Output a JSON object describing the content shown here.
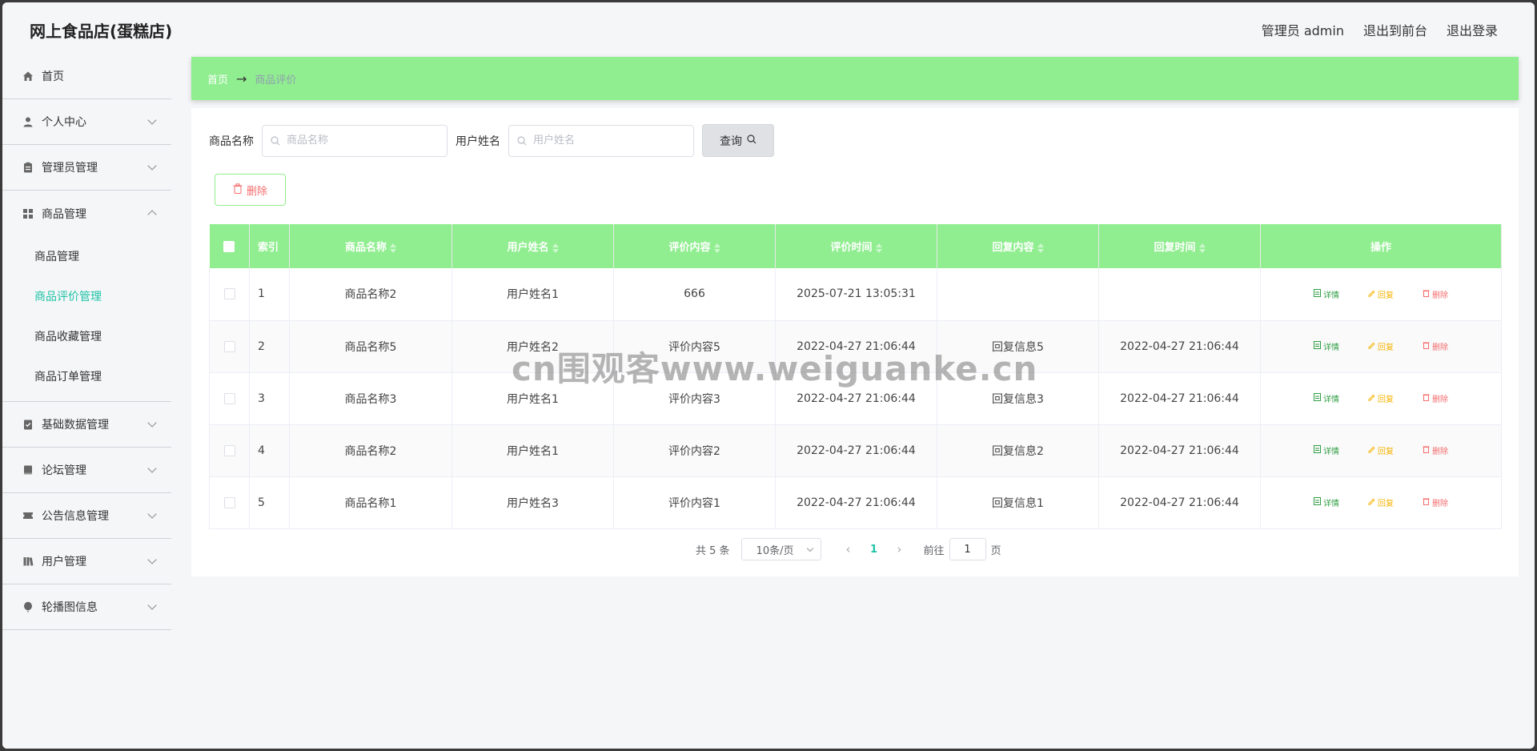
{
  "app": {
    "title": "网上食品店(蛋糕店)"
  },
  "topnav": {
    "admin_label": "管理员 admin",
    "front_link": "退出到前台",
    "logout_link": "退出登录"
  },
  "sidebar": {
    "items": [
      {
        "label": "首页"
      },
      {
        "label": "个人中心"
      },
      {
        "label": "管理员管理"
      },
      {
        "label": "商品管理",
        "children": [
          "商品管理",
          "商品评价管理",
          "商品收藏管理",
          "商品订单管理"
        ]
      },
      {
        "label": "基础数据管理"
      },
      {
        "label": "论坛管理"
      },
      {
        "label": "公告信息管理"
      },
      {
        "label": "用户管理"
      },
      {
        "label": "轮播图信息"
      }
    ]
  },
  "breadcrumb": {
    "home": "首页",
    "current": "商品评价"
  },
  "search": {
    "product_label": "商品名称",
    "product_placeholder": "商品名称",
    "user_label": "用户姓名",
    "user_placeholder": "用户姓名",
    "query_button": "查询"
  },
  "toolbar": {
    "delete_button": "删除"
  },
  "table": {
    "headers": [
      "索引",
      "商品名称",
      "用户姓名",
      "评价内容",
      "评价时间",
      "回复内容",
      "回复时间",
      "操作"
    ],
    "rows": [
      [
        "1",
        "商品名称2",
        "用户姓名1",
        "666",
        "2025-07-21 13:05:31",
        "",
        ""
      ],
      [
        "2",
        "商品名称5",
        "用户姓名2",
        "评价内容5",
        "2022-04-27 21:06:44",
        "回复信息5",
        "2022-04-27 21:06:44"
      ],
      [
        "3",
        "商品名称3",
        "用户姓名1",
        "评价内容3",
        "2022-04-27 21:06:44",
        "回复信息3",
        "2022-04-27 21:06:44"
      ],
      [
        "4",
        "商品名称2",
        "用户姓名1",
        "评价内容2",
        "2022-04-27 21:06:44",
        "回复信息2",
        "2022-04-27 21:06:44"
      ],
      [
        "5",
        "商品名称1",
        "用户姓名3",
        "评价内容1",
        "2022-04-27 21:06:44",
        "回复信息1",
        "2022-04-27 21:06:44"
      ]
    ],
    "actions": {
      "detail": "详情",
      "reply": "回复",
      "delete": "删除"
    }
  },
  "pagination": {
    "total": "共 5 条",
    "page_size": "10条/页",
    "current_page": "1",
    "goto_label": "前往",
    "goto_value": "1",
    "page_unit": "页"
  },
  "watermark": "cn围观客www.weiguanke.cn",
  "colors": {
    "header_green": "#90ee90",
    "active_teal": "#1ec3a6",
    "danger": "#f56c6c",
    "warning": "#f5b301",
    "success": "#2f9e44"
  }
}
